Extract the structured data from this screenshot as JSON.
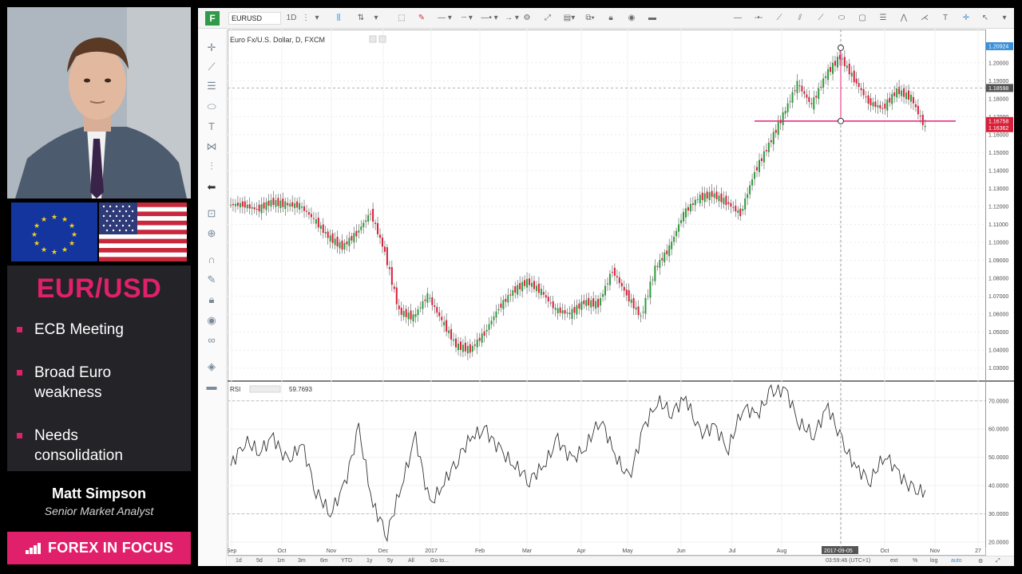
{
  "left_panel": {
    "pair": "EUR/USD",
    "bullets": [
      "ECB Meeting",
      "Broad Euro weakness",
      "Needs consolidation"
    ],
    "presenter_name": "Matt Simpson",
    "presenter_role": "Senior Market Analyst",
    "show_title": "FOREX IN FOCUS",
    "accent_color": "#e0206a"
  },
  "toolbar": {
    "logo": "F",
    "symbol": "EURUSD",
    "interval": "1D",
    "icons": [
      "more-icon",
      "candles-icon",
      "compare-icon",
      "indicators-icon",
      "pen-icon",
      "line-style-icon",
      "line-width-icon",
      "line-end-icon",
      "arrow-icon",
      "settings-icon",
      "snapshot-icon",
      "layers-icon",
      "copy-icon",
      "lock-icon",
      "eye-icon",
      "trash-icon",
      "horizontal-line-icon",
      "ray-icon",
      "trendline-icon",
      "channel-icon",
      "brush-icon",
      "ellipse-icon",
      "rectangle-icon",
      "fib-icon",
      "pattern-icon",
      "path-icon",
      "text-icon",
      "crosshair-icon",
      "cursor-icon"
    ]
  },
  "chart": {
    "title": "Euro Fx/U.S. Dollar, D, FXCM",
    "rsi_label": "RSI",
    "rsi_value": "59.7693",
    "crosshair_date": "2017-09-05",
    "status_time": "03:59:46 (UTC+1)",
    "price_tags": {
      "top": "1.20924",
      "crosshair": "1.18598",
      "line": "1.16758",
      "last": "1.16362"
    },
    "line_color": "#e2207a"
  },
  "bottom_bar": {
    "timeframes": [
      "1d",
      "5d",
      "1m",
      "3m",
      "6m",
      "YTD",
      "1y",
      "5y",
      "All",
      "Go to..."
    ],
    "options": [
      "ext",
      "%",
      "log",
      "auto"
    ]
  },
  "chart_data": [
    {
      "type": "candlestick",
      "title": "Euro Fx/U.S. Dollar, D, FXCM",
      "x_ticks": [
        "Sep",
        "Oct",
        "Nov",
        "Dec",
        "2017",
        "Feb",
        "Mar",
        "Apr",
        "May",
        "Jun",
        "Jul",
        "Aug",
        "2017-09-05",
        "Oct",
        "Nov",
        "27"
      ],
      "y_ticks": [
        "1.20000",
        "1.19000",
        "1.18000",
        "1.17000",
        "1.16000",
        "1.15000",
        "1.14000",
        "1.13000",
        "1.12000",
        "1.11000",
        "1.10000",
        "1.09000",
        "1.08000",
        "1.07000",
        "1.06000",
        "1.05000",
        "1.04000",
        "1.03000"
      ],
      "ylim": [
        1.025,
        1.215
      ],
      "series_close": [
        1.121,
        1.1182,
        1.1225,
        1.1212,
        1.1205,
        1.113,
        1.1032,
        1.0975,
        1.105,
        1.1165,
        1.0945,
        1.0615,
        1.0582,
        1.0705,
        1.0565,
        1.0425,
        1.0402,
        1.0495,
        1.0635,
        1.0728,
        1.0782,
        1.0725,
        1.0625,
        1.0602,
        1.0668,
        1.0655,
        1.0845,
        1.0708,
        1.0585,
        1.0855,
        1.0968,
        1.1162,
        1.1245,
        1.1268,
        1.1225,
        1.1158,
        1.1392,
        1.1545,
        1.1708,
        1.1885,
        1.1765,
        1.1932,
        1.2035,
        1.1908,
        1.1782,
        1.1745,
        1.1845,
        1.1805,
        1.1636
      ],
      "grid": "dashed gridlines"
    },
    {
      "type": "line",
      "title": "RSI",
      "last_value": 59.7693,
      "y_ticks": [
        "70.0000",
        "60.0000",
        "50.0000",
        "40.0000",
        "30.0000",
        "20.0000"
      ],
      "ylim": [
        18,
        77
      ],
      "levels": [
        70,
        30
      ],
      "values": [
        47,
        56,
        52,
        57,
        48,
        55,
        38,
        30,
        40,
        60,
        33,
        23,
        40,
        57,
        33,
        41,
        50,
        58,
        59,
        52,
        47,
        42,
        47,
        56,
        49,
        54,
        64,
        51,
        42,
        60,
        70,
        66,
        71,
        58,
        61,
        53,
        68,
        65,
        73,
        74,
        62,
        58,
        68,
        55,
        46,
        42,
        51,
        44,
        38
      ]
    }
  ]
}
